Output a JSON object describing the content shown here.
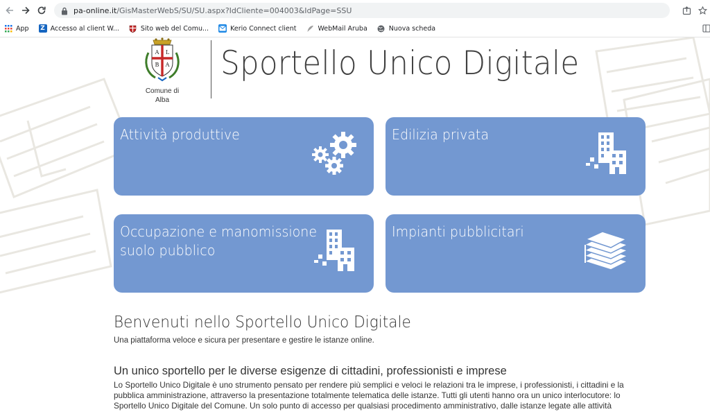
{
  "browser": {
    "url_host": "pa-online.it",
    "url_path": "/GisMasterWebS/SU/SU.aspx?IdCliente=004003&IdPage=SSU"
  },
  "bookmarks": [
    {
      "label": "App",
      "icon": "apps-grid-icon"
    },
    {
      "label": "Accesso al client W...",
      "icon": "z-logo-icon"
    },
    {
      "label": "Sito web del Comu...",
      "icon": "city-crest-icon"
    },
    {
      "label": "Kerio Connect client",
      "icon": "kerio-icon"
    },
    {
      "label": "WebMail Aruba",
      "icon": "feather-icon"
    },
    {
      "label": "Nuova scheda",
      "icon": "globe-icon"
    }
  ],
  "header": {
    "logo_caption_1": "Comune di",
    "logo_caption_2": "Alba",
    "crest_letters": [
      "A",
      "L",
      "B",
      "A"
    ],
    "title": "Sportello Unico Digitale"
  },
  "tiles": [
    {
      "label": "Attività produttive",
      "icon": "gears-icon"
    },
    {
      "label": "Edilizia privata",
      "icon": "buildings-icon"
    },
    {
      "label_line1": "Occupazione e manomissione",
      "label_line2": "suolo pubblico",
      "icon": "buildings-icon"
    },
    {
      "label": "Impianti pubblicitari",
      "icon": "paper-stack-icon"
    }
  ],
  "welcome": {
    "heading": "Benvenuti nello Sportello Unico Digitale",
    "subtitle": "Una piattaforma veloce e sicura per presentare e gestire le istanze online."
  },
  "section": {
    "heading": "Un unico sportello per le diverse esigenze di cittadini, professionisti e imprese",
    "paragraph": "Lo Sportello Unico Digitale è uno strumento pensato per rendere più semplici e veloci le relazioni tra le imprese, i professionisti, i cittadini e la pubblica amministrazione, attraverso la presentazione totalmente telematica delle istanze. Tutti gli utenti hanno ora un unico interlocutore: lo Sportello Unico Digitale del Comune. Un solo punto di accesso per qualsiasi procedimento amministrativo, dalle istanze legate alle attività"
  },
  "colors": {
    "tile": "#7398d1",
    "title_text": "#404040"
  }
}
